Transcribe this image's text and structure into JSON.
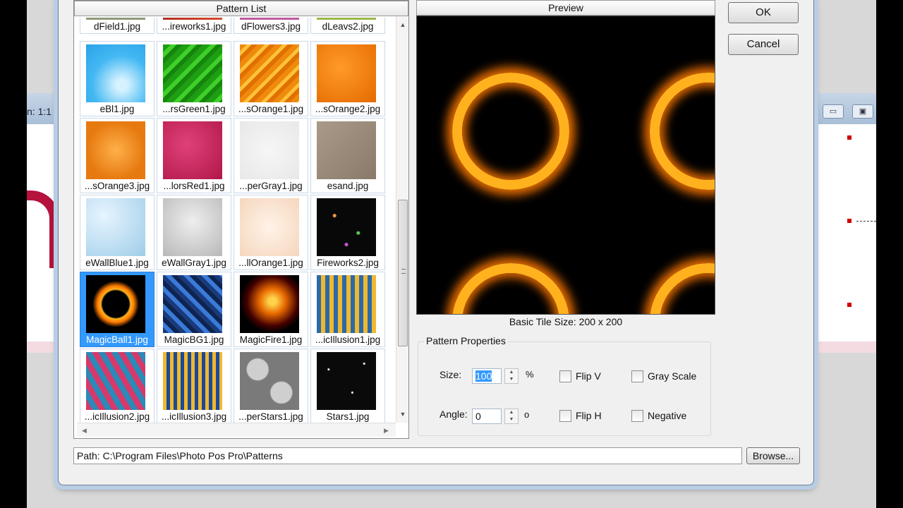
{
  "background_app": {
    "zoom_text": "n: 1:1"
  },
  "pattern_list": {
    "title": "Pattern List",
    "items": [
      {
        "label": "dField1.jpg",
        "style": "field"
      },
      {
        "label": "...ireworks1.jpg",
        "style": "redfire"
      },
      {
        "label": "dFlowers3.jpg",
        "style": "flowers"
      },
      {
        "label": "dLeavs2.jpg",
        "style": "leaves"
      },
      {
        "label": "eBl1.jpg",
        "style": "bluesky"
      },
      {
        "label": "...rsGreen1.jpg",
        "style": "green"
      },
      {
        "label": "...sOrange1.jpg",
        "style": "orange1"
      },
      {
        "label": "...sOrange2.jpg",
        "style": "orange2"
      },
      {
        "label": "...sOrange3.jpg",
        "style": "orange3"
      },
      {
        "label": "...lorsRed1.jpg",
        "style": "red"
      },
      {
        "label": "...perGray1.jpg",
        "style": "papergray"
      },
      {
        "label": "esand.jpg",
        "style": "sand"
      },
      {
        "label": "eWallBlue1.jpg",
        "style": "wallblue"
      },
      {
        "label": "eWallGray1.jpg",
        "style": "wallgray"
      },
      {
        "label": "...llOrange1.jpg",
        "style": "wallorange"
      },
      {
        "label": "Fireworks2.jpg",
        "style": "fireworks"
      },
      {
        "label": "MagicBall1.jpg",
        "style": "magicball",
        "selected": true
      },
      {
        "label": "MagicBG1.jpg",
        "style": "magicbg"
      },
      {
        "label": "MagicFire1.jpg",
        "style": "magicfire"
      },
      {
        "label": "...icIllusion1.jpg",
        "style": "illusion1"
      },
      {
        "label": "...icIllusion2.jpg",
        "style": "illusion2"
      },
      {
        "label": "...icIllusion3.jpg",
        "style": "illusion3"
      },
      {
        "label": "...perStars1.jpg",
        "style": "stars1"
      },
      {
        "label": "Stars1.jpg",
        "style": "starsblack"
      }
    ]
  },
  "preview": {
    "title": "Preview",
    "tile_size": "Basic Tile Size: 200 x 200"
  },
  "properties": {
    "legend": "Pattern Properties",
    "size_label": "Size:",
    "size_value": "100",
    "size_unit": "%",
    "angle_label": "Angle:",
    "angle_value": "0",
    "angle_unit": "o",
    "flip_v": "Flip V",
    "flip_h": "Flip H",
    "gray_scale": "Gray Scale",
    "negative": "Negative"
  },
  "buttons": {
    "ok": "OK",
    "cancel": "Cancel",
    "browse": "Browse..."
  },
  "path": "Path: C:\\Program Files\\Photo Pos Pro\\Patterns"
}
